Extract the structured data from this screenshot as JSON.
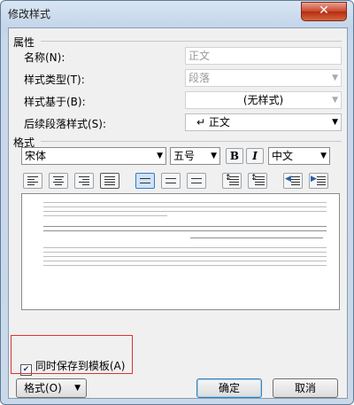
{
  "window": {
    "title": "修改样式",
    "close_glyph": "✕"
  },
  "properties": {
    "section_title": "属性",
    "name_label": "名称(N):",
    "name_value": "正文",
    "type_label": "样式类型(T):",
    "type_value": "段落",
    "based_on_label": "样式基于(B):",
    "based_on_value": "(无样式)",
    "next_label": "后续段落样式(S):",
    "next_icon": "↵",
    "next_value": "正文"
  },
  "format": {
    "section_title": "格式",
    "font_value": "宋体",
    "size_value": "五号",
    "bold_label": "B",
    "italic_label": "I",
    "script_value": "中文",
    "align_buttons": [
      "align-left-icon",
      "align-center-icon",
      "align-right-icon",
      "justify-icon"
    ],
    "selected_align": "justify-icon",
    "spacing_buttons": [
      "line-spacing-single-icon",
      "line-spacing-1_5-icon",
      "line-spacing-double-icon"
    ],
    "selected_spacing": "line-spacing-single-icon",
    "para_buttons": [
      "space-before-icon",
      "space-after-icon",
      "decrease-indent-icon",
      "increase-indent-icon"
    ]
  },
  "bottom": {
    "save_to_template_label": "同时保存到模板(A)",
    "save_to_template_checked": true,
    "checkbox_glyph": "✔",
    "format_menu_label": "格式(O)",
    "ok_label": "确定",
    "cancel_label": "取消"
  },
  "colors": {
    "highlight_box": "#dd3333",
    "selected_button": "#cfe3f8"
  }
}
